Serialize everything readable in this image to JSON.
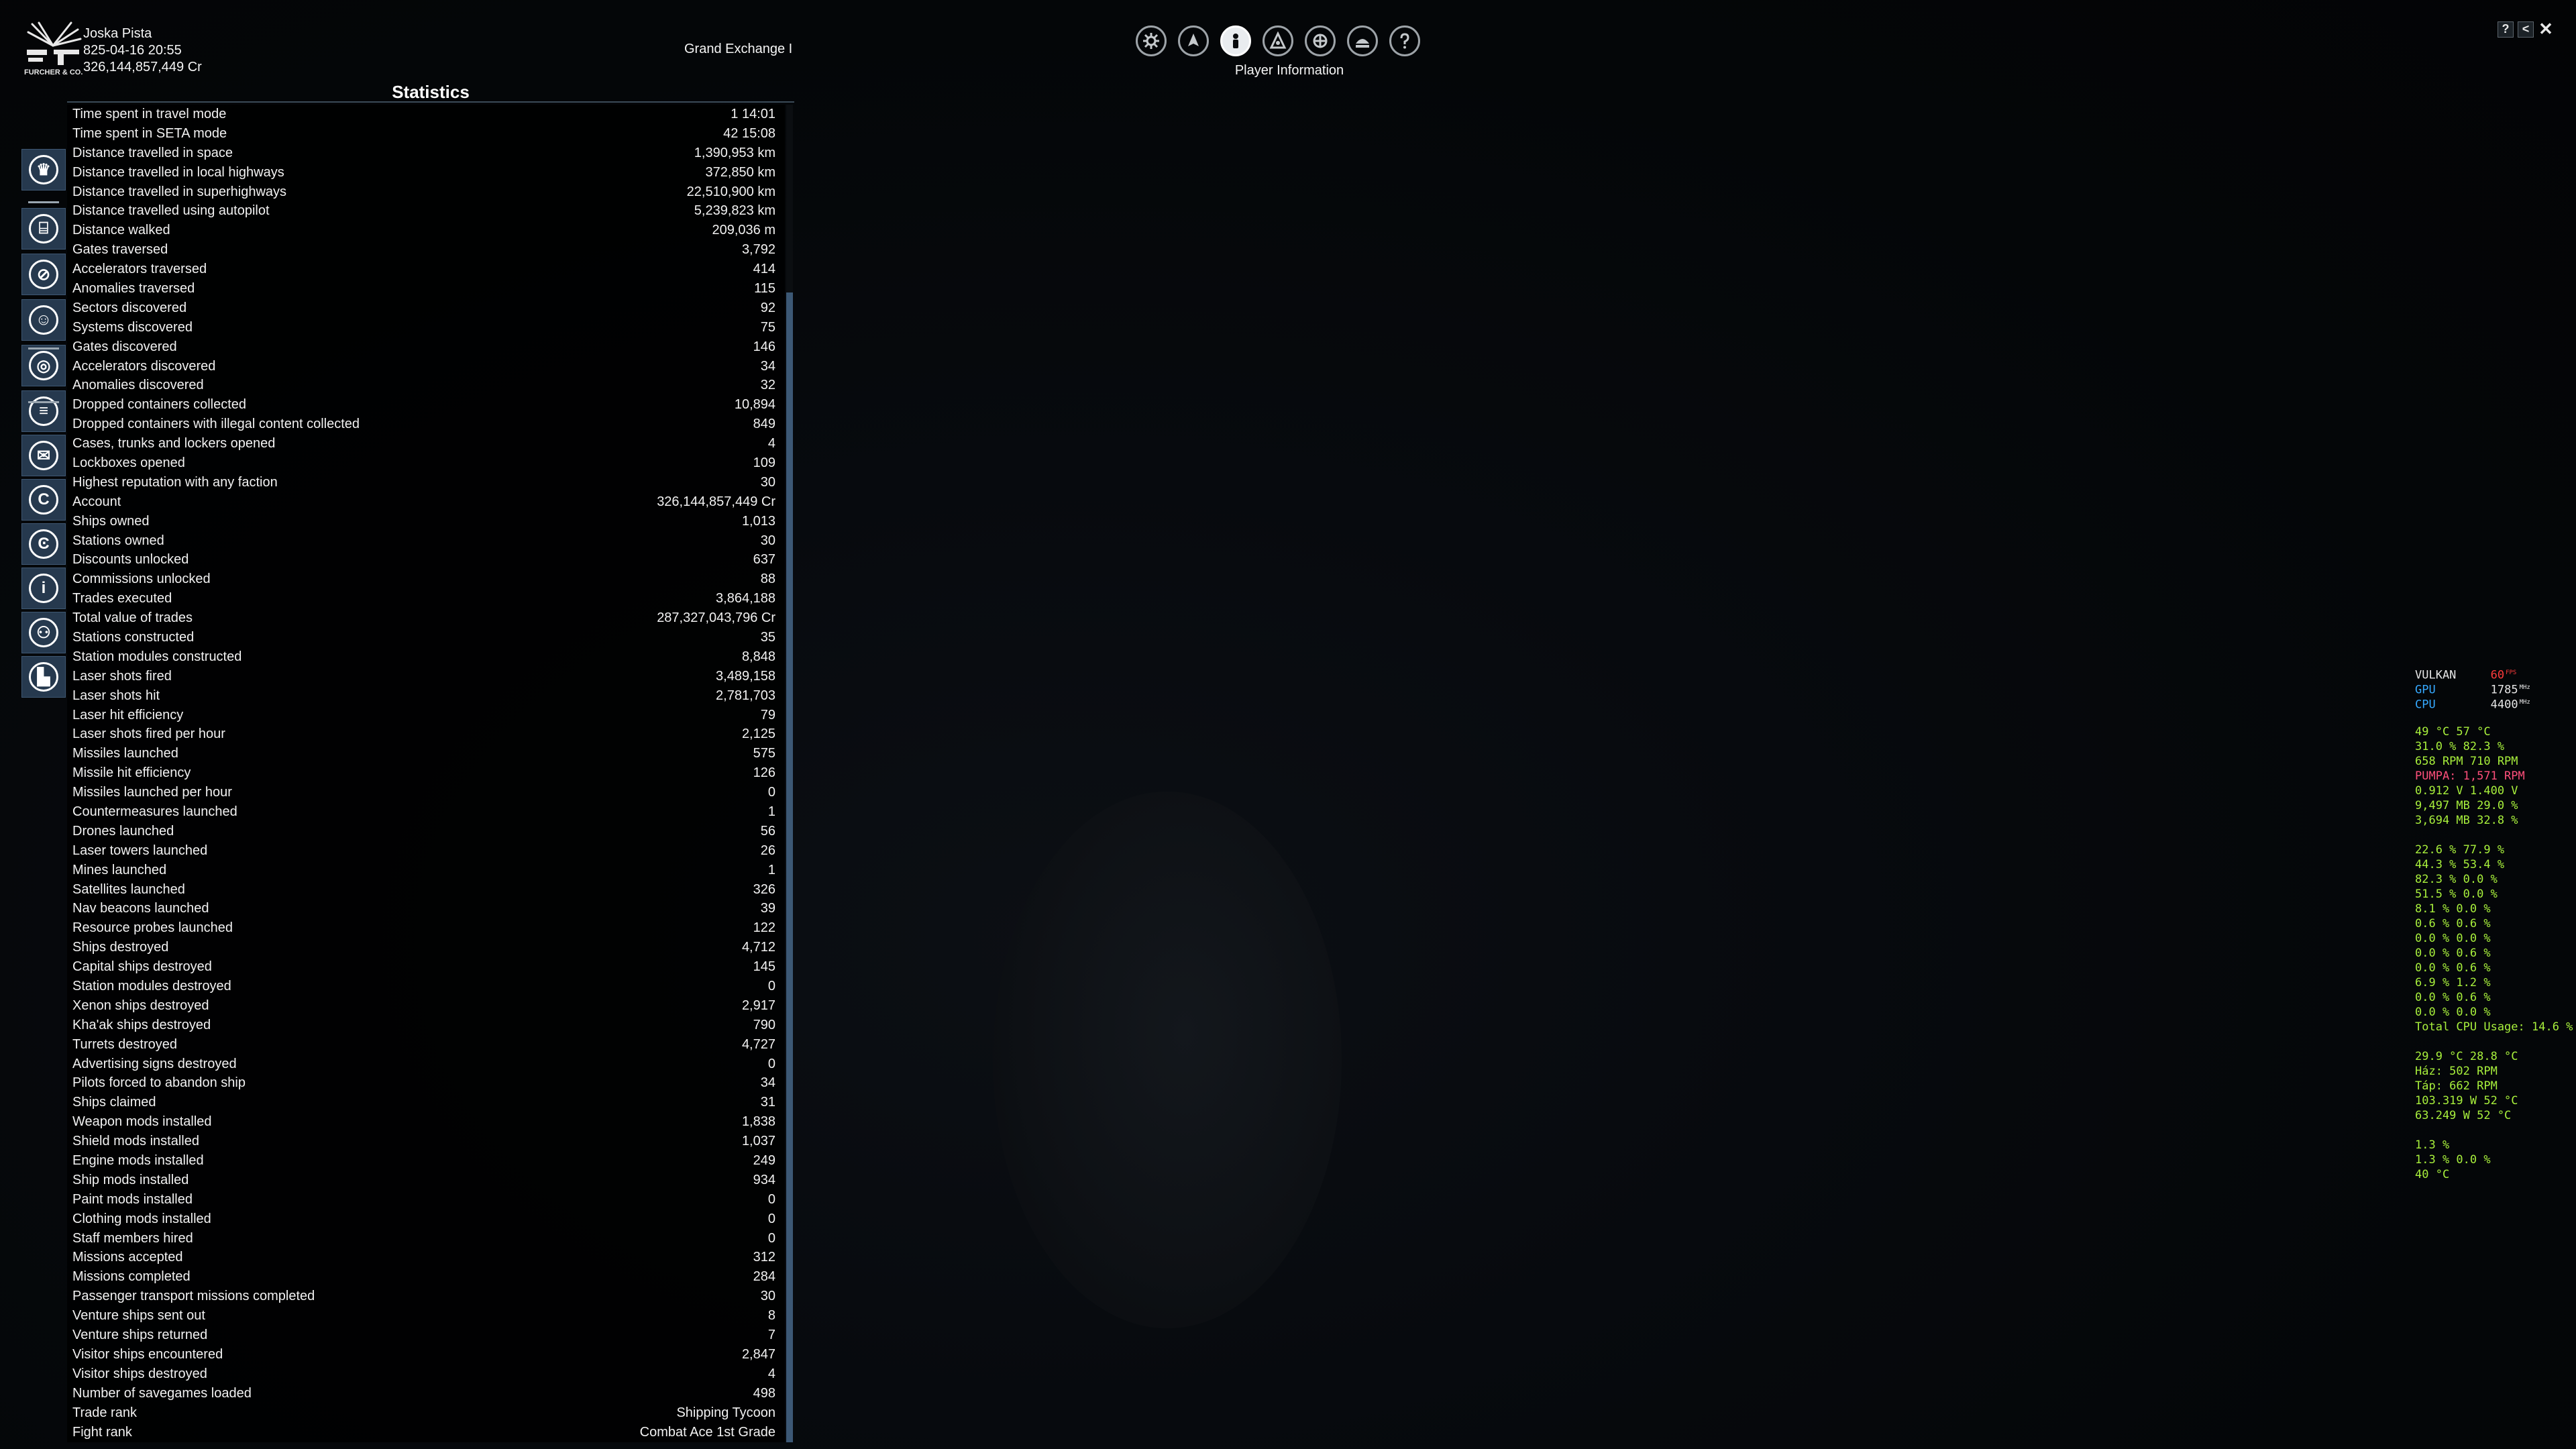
{
  "header": {
    "logo_text": "FURCHER & CO.",
    "player_name": "Joska Pista",
    "datetime": "825-04-16 20:55",
    "credits": "326,144,857,449 Cr",
    "location": "Grand Exchange I"
  },
  "top_menu": {
    "title": "Player Information",
    "icons": [
      "gear-icon",
      "ship-icon",
      "player-icon",
      "faction-icon",
      "empire-icon",
      "encyclopedia-icon",
      "help-icon"
    ],
    "active_index": 2
  },
  "window_controls": {
    "help": "?",
    "back": "<",
    "close": "✕"
  },
  "statistics": {
    "title": "Statistics",
    "rows": [
      {
        "label": "Time spent in travel mode",
        "value": "1 14:01"
      },
      {
        "label": "Time spent in SETA mode",
        "value": "42 15:08"
      },
      {
        "label": "Distance travelled in space",
        "value": "1,390,953 km"
      },
      {
        "label": "Distance travelled in local highways",
        "value": "372,850 km"
      },
      {
        "label": "Distance travelled in superhighways",
        "value": "22,510,900 km"
      },
      {
        "label": "Distance travelled using autopilot",
        "value": "5,239,823 km"
      },
      {
        "label": "Distance walked",
        "value": "209,036 m"
      },
      {
        "label": "Gates traversed",
        "value": "3,792"
      },
      {
        "label": "Accelerators traversed",
        "value": "414"
      },
      {
        "label": "Anomalies traversed",
        "value": "115"
      },
      {
        "label": "Sectors discovered",
        "value": "92"
      },
      {
        "label": "Systems discovered",
        "value": "75"
      },
      {
        "label": "Gates discovered",
        "value": "146"
      },
      {
        "label": "Accelerators discovered",
        "value": "34"
      },
      {
        "label": "Anomalies discovered",
        "value": "32"
      },
      {
        "label": "Dropped containers collected",
        "value": "10,894"
      },
      {
        "label": "Dropped containers with illegal content collected",
        "value": "849"
      },
      {
        "label": "Cases, trunks and lockers opened",
        "value": "4"
      },
      {
        "label": "Lockboxes opened",
        "value": "109"
      },
      {
        "label": "Highest reputation with any faction",
        "value": "30"
      },
      {
        "label": "Account",
        "value": "326,144,857,449 Cr"
      },
      {
        "label": "Ships owned",
        "value": "1,013"
      },
      {
        "label": "Stations owned",
        "value": "30"
      },
      {
        "label": "Discounts unlocked",
        "value": "637"
      },
      {
        "label": "Commissions unlocked",
        "value": "88"
      },
      {
        "label": "Trades executed",
        "value": "3,864,188"
      },
      {
        "label": "Total value of trades",
        "value": "287,327,043,796 Cr"
      },
      {
        "label": "Stations constructed",
        "value": "35"
      },
      {
        "label": "Station modules constructed",
        "value": "8,848"
      },
      {
        "label": "Laser shots fired",
        "value": "3,489,158"
      },
      {
        "label": "Laser shots hit",
        "value": "2,781,703"
      },
      {
        "label": "Laser hit efficiency",
        "value": "79"
      },
      {
        "label": "Laser shots fired per hour",
        "value": "2,125"
      },
      {
        "label": "Missiles launched",
        "value": "575"
      },
      {
        "label": "Missile hit efficiency",
        "value": "126"
      },
      {
        "label": "Missiles launched per hour",
        "value": "0"
      },
      {
        "label": "Countermeasures launched",
        "value": "1"
      },
      {
        "label": "Drones launched",
        "value": "56"
      },
      {
        "label": "Laser towers launched",
        "value": "26"
      },
      {
        "label": "Mines launched",
        "value": "1"
      },
      {
        "label": "Satellites launched",
        "value": "326"
      },
      {
        "label": "Nav beacons launched",
        "value": "39"
      },
      {
        "label": "Resource probes launched",
        "value": "122"
      },
      {
        "label": "Ships destroyed",
        "value": "4,712"
      },
      {
        "label": "Capital ships destroyed",
        "value": "145"
      },
      {
        "label": "Station modules destroyed",
        "value": "0"
      },
      {
        "label": "Xenon ships destroyed",
        "value": "2,917"
      },
      {
        "label": "Kha'ak ships destroyed",
        "value": "790"
      },
      {
        "label": "Turrets destroyed",
        "value": "4,727"
      },
      {
        "label": "Advertising signs destroyed",
        "value": "0"
      },
      {
        "label": "Pilots forced to abandon ship",
        "value": "34"
      },
      {
        "label": "Ships claimed",
        "value": "31"
      },
      {
        "label": "Weapon mods installed",
        "value": "1,838"
      },
      {
        "label": "Shield mods installed",
        "value": "1,037"
      },
      {
        "label": "Engine mods installed",
        "value": "249"
      },
      {
        "label": "Ship mods installed",
        "value": "934"
      },
      {
        "label": "Paint mods installed",
        "value": "0"
      },
      {
        "label": "Clothing mods installed",
        "value": "0"
      },
      {
        "label": "Staff members hired",
        "value": "0"
      },
      {
        "label": "Missions accepted",
        "value": "312"
      },
      {
        "label": "Missions completed",
        "value": "284"
      },
      {
        "label": "Passenger transport missions completed",
        "value": "30"
      },
      {
        "label": "Venture ships sent out",
        "value": "8"
      },
      {
        "label": "Venture ships returned",
        "value": "7"
      },
      {
        "label": "Visitor ships encountered",
        "value": "2,847"
      },
      {
        "label": "Visitor ships destroyed",
        "value": "4"
      },
      {
        "label": "Number of savegames loaded",
        "value": "498"
      },
      {
        "label": "Trade rank",
        "value": "Shipping Tycoon"
      },
      {
        "label": "Fight rank",
        "value": "Combat Ace 1st Grade"
      }
    ]
  },
  "sidebar_icons": [
    {
      "name": "crown-icon",
      "glyph": "♛"
    },
    {
      "name": "logbook-icon",
      "glyph": "⌸"
    },
    {
      "name": "compass-icon",
      "glyph": "⊘"
    },
    {
      "name": "character-icon",
      "glyph": "☺"
    },
    {
      "name": "target-icon",
      "glyph": "◎"
    },
    {
      "name": "inventory-icon",
      "glyph": "≡"
    },
    {
      "name": "mail-icon",
      "glyph": "✉"
    },
    {
      "name": "credits-icon",
      "glyph": "C"
    },
    {
      "name": "ce-icon",
      "glyph": "Ͼ"
    },
    {
      "name": "info-icon",
      "glyph": "i"
    },
    {
      "name": "staff-icon",
      "glyph": "⚇"
    },
    {
      "name": "stats-chart-icon",
      "glyph": "▙"
    }
  ],
  "hw_overlay": {
    "api": {
      "label": "VULKAN",
      "value": "60",
      "unit": "FPS"
    },
    "gpu": {
      "label": "GPU",
      "value": "1785",
      "unit": "MHz"
    },
    "cpu": {
      "label": "CPU",
      "value": "4400",
      "unit": "MHz"
    },
    "group1": [
      "49 °C 57 °C",
      "31.0 % 82.3 %",
      "658 RPM 710 RPM",
      "PUMPA: 1,571 RPM",
      "0.912 V 1.400 V",
      "9,497 MB 29.0 %",
      "3,694 MB 32.8 %"
    ],
    "group2": [
      "22.6 % 77.9 %",
      "44.3 % 53.4 %",
      "82.3 % 0.0 %",
      "51.5 % 0.0 %",
      "8.1 % 0.0 %",
      "0.6 % 0.6 %",
      "0.0 % 0.0 %",
      "0.0 % 0.6 %",
      "0.0 % 0.6 %",
      "6.9 % 1.2 %",
      "0.0 % 0.6 %",
      "0.0 % 0.0 %",
      "Total CPU Usage: 14.6 %"
    ],
    "group3": [
      "29.9 °C 28.8 °C",
      "Ház: 502 RPM",
      "Táp: 662 RPM",
      "103.319 W 52 °C",
      "63.249 W 52 °C"
    ],
    "group4": [
      "1.3 %",
      "1.3 % 0.0 %",
      "40 °C"
    ],
    "colors": {
      "green": "#a8f03c",
      "red": "#ff3b3b",
      "blue": "#35a8ff",
      "pink": "#ff4f7b"
    }
  }
}
